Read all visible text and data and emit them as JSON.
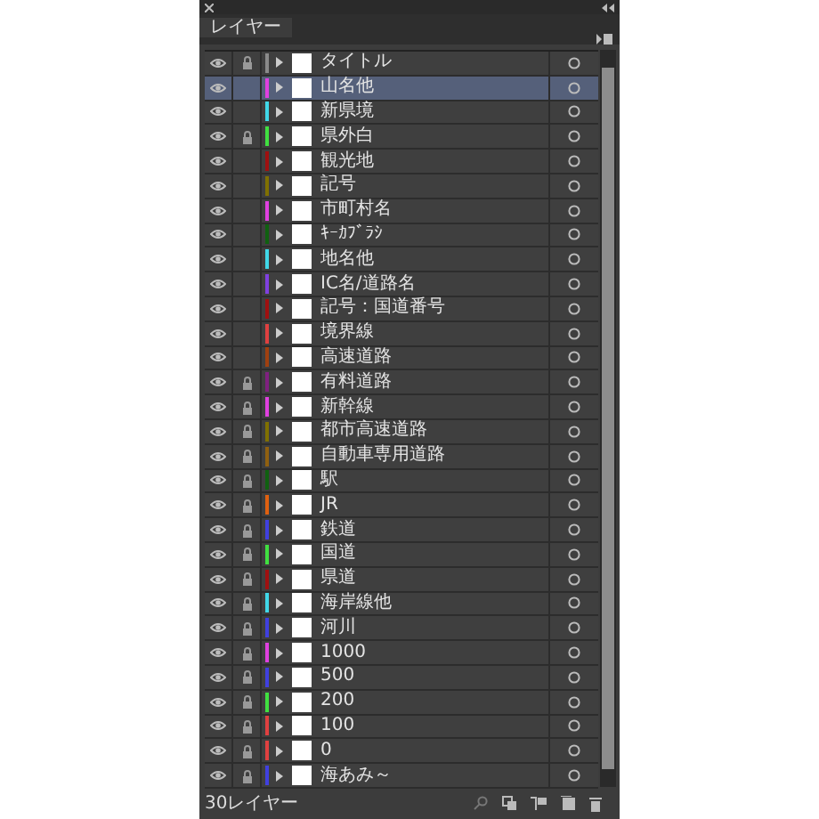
{
  "panel": {
    "tab": {
      "label": "レイヤー",
      "selected": true
    }
  },
  "layers": [
    {
      "name": "タイトル",
      "color": "#8a8a8a",
      "visible": true,
      "locked": true,
      "selected": false
    },
    {
      "name": "山名他",
      "color": "#e040e0",
      "visible": true,
      "locked": false,
      "selected": true
    },
    {
      "name": "新県境",
      "color": "#40d8e8",
      "visible": true,
      "locked": false,
      "selected": false
    },
    {
      "name": "県外白",
      "color": "#40e040",
      "visible": true,
      "locked": true,
      "selected": false
    },
    {
      "name": "観光地",
      "color": "#a01010",
      "visible": true,
      "locked": false,
      "selected": false
    },
    {
      "name": "記号",
      "color": "#807000",
      "visible": true,
      "locked": false,
      "selected": false
    },
    {
      "name": "市町村名",
      "color": "#e040e0",
      "visible": true,
      "locked": false,
      "selected": false
    },
    {
      "name": "ｷｰｶﾌﾞﾗｼ",
      "color": "#106010",
      "visible": true,
      "locked": false,
      "selected": false
    },
    {
      "name": "地名他",
      "color": "#40d8e8",
      "visible": true,
      "locked": false,
      "selected": false
    },
    {
      "name": "IC名/道路名",
      "color": "#8040e0",
      "visible": true,
      "locked": false,
      "selected": false
    },
    {
      "name": "記号：国道番号",
      "color": "#a01010",
      "visible": true,
      "locked": false,
      "selected": false
    },
    {
      "name": "境界線",
      "color": "#e04040",
      "visible": true,
      "locked": false,
      "selected": false
    },
    {
      "name": "高速道路",
      "color": "#a04010",
      "visible": true,
      "locked": false,
      "selected": false
    },
    {
      "name": "有料道路",
      "color": "#802080",
      "visible": true,
      "locked": true,
      "selected": false
    },
    {
      "name": "新幹線",
      "color": "#e040e0",
      "visible": true,
      "locked": true,
      "selected": false
    },
    {
      "name": "都市高速道路",
      "color": "#807000",
      "visible": true,
      "locked": true,
      "selected": false
    },
    {
      "name": "自動車専用道路",
      "color": "#906010",
      "visible": true,
      "locked": true,
      "selected": false
    },
    {
      "name": "駅",
      "color": "#106010",
      "visible": true,
      "locked": true,
      "selected": false
    },
    {
      "name": "JR",
      "color": "#e06010",
      "visible": true,
      "locked": true,
      "selected": false
    },
    {
      "name": "鉄道",
      "color": "#4040e0",
      "visible": true,
      "locked": true,
      "selected": false
    },
    {
      "name": "国道",
      "color": "#40e040",
      "visible": true,
      "locked": true,
      "selected": false
    },
    {
      "name": "県道",
      "color": "#a01010",
      "visible": true,
      "locked": true,
      "selected": false
    },
    {
      "name": "海岸線他",
      "color": "#40d8e8",
      "visible": true,
      "locked": true,
      "selected": false
    },
    {
      "name": "河川",
      "color": "#4040e0",
      "visible": true,
      "locked": true,
      "selected": false
    },
    {
      "name": "1000",
      "color": "#e040e0",
      "visible": true,
      "locked": true,
      "selected": false
    },
    {
      "name": "500",
      "color": "#4040e0",
      "visible": true,
      "locked": true,
      "selected": false
    },
    {
      "name": "200",
      "color": "#40e040",
      "visible": true,
      "locked": true,
      "selected": false
    },
    {
      "name": "100",
      "color": "#e04040",
      "visible": true,
      "locked": true,
      "selected": false
    },
    {
      "name": "0",
      "color": "#e04040",
      "visible": true,
      "locked": true,
      "selected": false
    },
    {
      "name": "海あみ～",
      "color": "#4040e0",
      "visible": true,
      "locked": true,
      "selected": false
    }
  ],
  "footer": {
    "count": "30レイヤー"
  }
}
